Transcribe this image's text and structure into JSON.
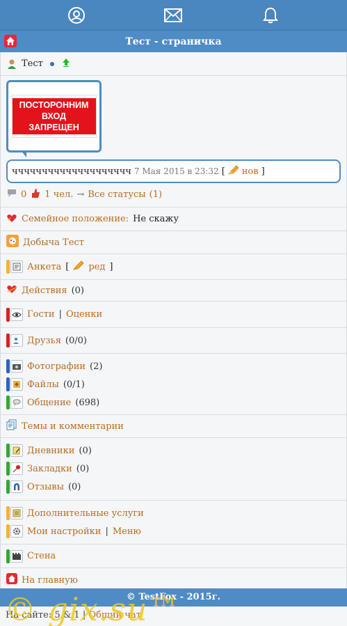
{
  "topbar": {
    "icons": [
      "profile-icon",
      "mail-icon",
      "bell-icon"
    ]
  },
  "title": "Тест - страничка",
  "user": {
    "name": "Тест"
  },
  "avatar": {
    "sign_lines": [
      "ПОСТОРОННИМ",
      "ВХОД",
      "ЗАПРЕЩЕН"
    ]
  },
  "status": {
    "text": "чччччччччччччччччччч",
    "date": "7 Мая 2015 в 23:32",
    "bracket_open": "[",
    "new_link": "нов",
    "bracket_close": "]",
    "comments_count": "0",
    "likes_text": "1 чел.",
    "arrow": "→",
    "all_statuses": "Все статусы",
    "all_statuses_count": "(1)"
  },
  "family": {
    "label": "Семейное положение:",
    "value": "Не скажу"
  },
  "loot": "Добыча Тест",
  "menu": {
    "anketa": "Анкета",
    "edit_open": "[",
    "edit": "ред",
    "edit_close": "]",
    "actions": "Действия",
    "actions_count": "(0)",
    "guests": "Гости",
    "sep": "|",
    "ratings": "Оценки",
    "friends": "Друзья",
    "friends_count": "(0/0)",
    "photos": "Фотографии",
    "photos_count": "(2)",
    "files": "Файлы",
    "files_count": "(0/1)",
    "chat": "Общение",
    "chat_count": "(698)",
    "topics": "Темы и комментарии",
    "diaries": "Дневники",
    "diaries_count": "(0)",
    "bookmarks": "Закладки",
    "bookmarks_count": "(0)",
    "reviews": "Отзывы",
    "reviews_count": "(0)",
    "extra": "Дополнительные услуги",
    "settings": "Мои настройки",
    "menu": "Меню",
    "wall": "Стена",
    "home": "На главную"
  },
  "footer": "© TestFox - 2015г.",
  "online": {
    "prefix": "На сайте:",
    "text": "5 & 1",
    "general": "Общий чат"
  },
  "watermark": "© gix.su™"
}
